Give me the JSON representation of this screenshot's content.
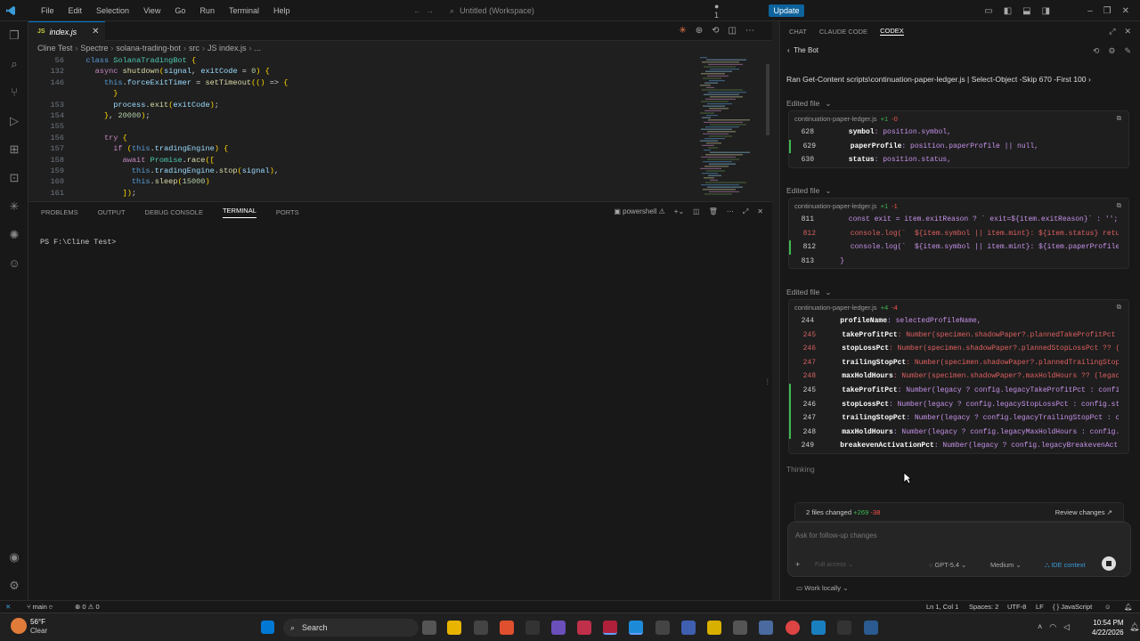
{
  "titlebar": {
    "menus": [
      "File",
      "Edit",
      "Selection",
      "View",
      "Go",
      "Run",
      "Terminal",
      "Help"
    ],
    "command_center": "Untitled (Workspace)",
    "update": "Update",
    "notif": "1"
  },
  "editor": {
    "tab": "index.js",
    "breadcrumb": [
      "Cline Test",
      "Spectre",
      "solana-trading-bot",
      "src",
      "JS index.js",
      "..."
    ],
    "lines": [
      {
        "n": "56",
        "t": "  class SolanaTradingBot {"
      },
      {
        "n": "132",
        "t": "    async shutdown(signal, exitCode = 0) {"
      },
      {
        "n": "146",
        "t": "      this.forceExitTimer = setTimeout(() => {"
      },
      {
        "n": "",
        "t": "        }"
      },
      {
        "n": "153",
        "t": "        process.exit(exitCode);"
      },
      {
        "n": "154",
        "t": "      }, 20000);"
      },
      {
        "n": "155",
        "t": ""
      },
      {
        "n": "156",
        "t": "      try {"
      },
      {
        "n": "157",
        "t": "        if (this.tradingEngine) {"
      },
      {
        "n": "158",
        "t": "          await Promise.race(["
      },
      {
        "n": "159",
        "t": "            this.tradingEngine.stop(signal),"
      },
      {
        "n": "160",
        "t": "            this.sleep(15000)"
      },
      {
        "n": "161",
        "t": "          ]);"
      }
    ]
  },
  "panel": {
    "tabs": [
      "PROBLEMS",
      "OUTPUT",
      "DEBUG CONSOLE",
      "TERMINAL",
      "PORTS"
    ],
    "active": "TERMINAL",
    "shell": "powershell",
    "prompt": "PS F:\\Cline Test>"
  },
  "right": {
    "tabs": [
      "CHAT",
      "CLAUDE CODE",
      "CODEX"
    ],
    "active": "CODEX",
    "thread": "The Bot",
    "ran": "Ran Get-Content scripts\\continuation-paper-ledger.js | Select-Object -Skip 670 -First 100",
    "edited_label": "Edited file",
    "blocks": [
      {
        "file": "continuation-paper-ledger.js",
        "add": "+1",
        "del": "-0",
        "lines": [
          {
            "k": "ctx",
            "n": "628",
            "t": "      symbol: position.symbol,"
          },
          {
            "k": "plus",
            "n": "629",
            "t": "      paperProfile: position.paperProfile || null,"
          },
          {
            "k": "ctx",
            "n": "630",
            "t": "      status: position.status,"
          }
        ]
      },
      {
        "file": "continuation-paper-ledger.js",
        "add": "+1",
        "del": "-1",
        "lines": [
          {
            "k": "ctx",
            "n": "811",
            "t": "      const exit = item.exitReason ? ` exit=${item.exitReason}` : '';"
          },
          {
            "k": "minus",
            "n": "812",
            "t": "      console.log(`  ${item.symbol || item.mint}: ${item.status} return"
          },
          {
            "k": "plus",
            "n": "812",
            "t": "      console.log(`  ${item.symbol || item.mint}: ${item.paperProfile |"
          },
          {
            "k": "ctx",
            "n": "813",
            "t": "    }"
          }
        ]
      },
      {
        "file": "continuation-paper-ledger.js",
        "add": "+4",
        "del": "-4",
        "lines": [
          {
            "k": "ctx",
            "n": "244",
            "t": "    profileName: selectedProfileName,"
          },
          {
            "k": "minus",
            "n": "245",
            "t": "    takeProfitPct: Number(specimen.shadowPaper?.plannedTakeProfitPct"
          },
          {
            "k": "minus",
            "n": "246",
            "t": "    stopLossPct: Number(specimen.shadowPaper?.plannedStopLossPct ?? ("
          },
          {
            "k": "minus",
            "n": "247",
            "t": "    trailingStopPct: Number(specimen.shadowPaper?.plannedTrailingStop"
          },
          {
            "k": "minus",
            "n": "248",
            "t": "    maxHoldHours: Number(specimen.shadowPaper?.maxHoldHours ?? (legac"
          },
          {
            "k": "plus",
            "n": "245",
            "t": "    takeProfitPct: Number(legacy ? config.legacyTakeProfitPct : confi"
          },
          {
            "k": "plus",
            "n": "246",
            "t": "    stopLossPct: Number(legacy ? config.legacyStopLossPct : config.st"
          },
          {
            "k": "plus",
            "n": "247",
            "t": "    trailingStopPct: Number(legacy ? config.legacyTrailingStopPct : c"
          },
          {
            "k": "plus",
            "n": "248",
            "t": "    maxHoldHours: Number(legacy ? config.legacyMaxHoldHours : config."
          },
          {
            "k": "ctx",
            "n": "249",
            "t": "    breakevenActivationPct: Number(legacy ? config.legacyBreakevenAct"
          }
        ]
      }
    ],
    "thinking": "Thinking",
    "changes": {
      "summary": "2 files changed",
      "add": "+269",
      "del": "-38",
      "review": "Review changes ↗"
    },
    "input_placeholder": "Ask for follow-up changes",
    "model": "GPT-5.4",
    "effort": "Medium",
    "context": "IDE context",
    "mode": "Full access",
    "work": "Work locally"
  },
  "status": {
    "branch": "main",
    "errors": "0",
    "warnings": "0",
    "pos": "Ln 1, Col 1",
    "spaces": "Spaces: 2",
    "enc": "UTF-8",
    "eol": "LF",
    "lang": "JavaScript"
  },
  "taskbar": {
    "temp": "56°F",
    "weather": "Clear",
    "search": "Search",
    "time": "10:54 PM",
    "date": "4/22/2026"
  }
}
